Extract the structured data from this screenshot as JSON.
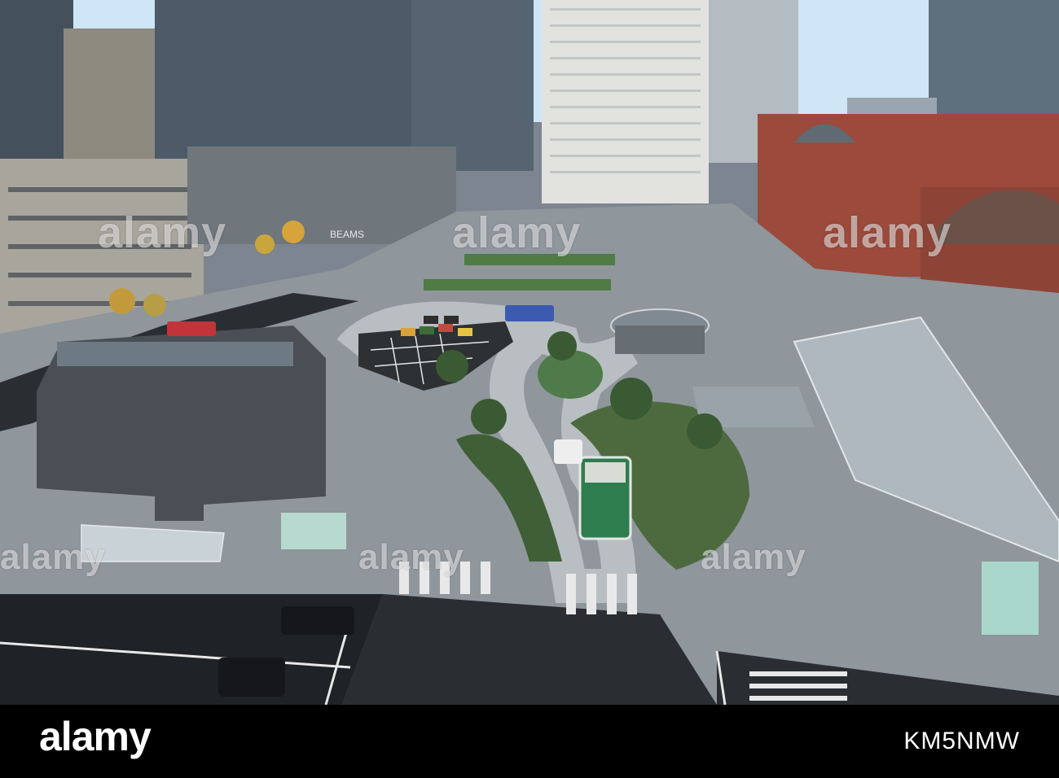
{
  "watermark": {
    "text": "alamy"
  },
  "footer": {
    "logo_text": "alamy",
    "image_id": "KM5NMW"
  },
  "scene": {
    "signs": {
      "store_sign": "BEAMS"
    }
  },
  "colors": {
    "sky": "#cfe6f6",
    "road": "#1f2226",
    "plaza": "#8f969c",
    "brick": "#9b4a3c",
    "roof": "#5f6a72",
    "grass": "#4f7b45",
    "bus": "#2e7d4f",
    "footer": "#000000"
  },
  "icons": {
    "watermark": "alamy-watermark-icon"
  }
}
